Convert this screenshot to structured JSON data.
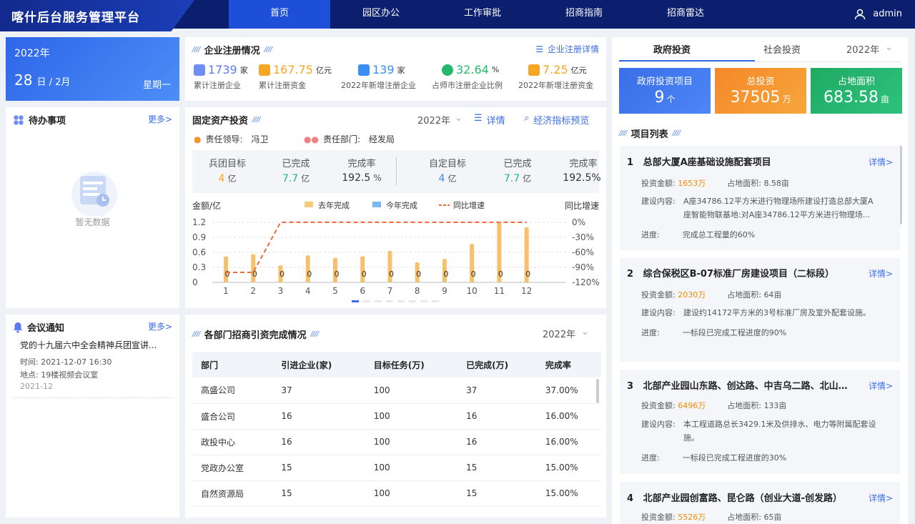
{
  "app": {
    "title": "喀什后台服务管理平台",
    "user": "admin"
  },
  "nav": [
    "首页",
    "园区办公",
    "工作审批",
    "招商指南",
    "招商雷达"
  ],
  "date": {
    "year": "2022年",
    "day": "28",
    "month": "日 / 2月",
    "weekday": "星期一"
  },
  "todo": {
    "title": "待办事项",
    "more": "更多>",
    "empty": "暂无数据"
  },
  "meeting": {
    "title": "会议通知",
    "more": "更多>",
    "item_title": "党的十九届六中全会精神兵团宣讲...",
    "time": "时间:  2021-12-07 16:30",
    "place": "地点:  19楼视频会议室",
    "date": "2021-12"
  },
  "reg": {
    "title": "企业注册情况",
    "detail": "企业注册详情",
    "stats": [
      {
        "value": "1739",
        "unit": "家",
        "label": "累计注册企业",
        "color": "#5b7bf2"
      },
      {
        "value": "167.75",
        "unit": "亿元",
        "label": "累计注册资金",
        "color": "#f5a623"
      },
      {
        "value": "139",
        "unit": "家",
        "label": "2022年新增注册企业",
        "color": "#3a8ef5"
      },
      {
        "value": "32.64",
        "unit": "%",
        "label": "占师市注册企业比例",
        "color": "#26b96e"
      },
      {
        "value": "7.25",
        "unit": "亿元",
        "label": "2022年新增注册资金",
        "color": "#f5a623"
      }
    ]
  },
  "fixed": {
    "title": "固定资产投资",
    "year": "2022年",
    "detail": "详情",
    "preview": "经济指标预览",
    "leader_label": "责任领导:",
    "leader": "冯卫",
    "dept_label": "责任部门:",
    "dept": "经发局",
    "targets": [
      {
        "label": "兵团目标",
        "value": "4",
        "unit": "亿"
      },
      {
        "label": "已完成",
        "value": "7.7",
        "unit": "亿"
      },
      {
        "label": "完成率",
        "value": "192.5",
        "unit": "%"
      },
      {
        "label": "自定目标",
        "value": "4",
        "unit": "亿"
      },
      {
        "label": "已完成",
        "value": "7.7",
        "unit": "亿"
      },
      {
        "label": "完成率",
        "value": "192.5%",
        "unit": ""
      }
    ]
  },
  "chart_data": {
    "type": "bar",
    "ylabel": "金额/亿",
    "y2label": "同比增速",
    "categories": [
      "1",
      "2",
      "3",
      "4",
      "5",
      "6",
      "7",
      "8",
      "9",
      "10",
      "11",
      "12"
    ],
    "series": [
      {
        "name": "去年完成",
        "values": [
          0.52,
          0.56,
          0.34,
          0.54,
          0.49,
          0.52,
          0.63,
          0.4,
          0.47,
          0.77,
          1.2,
          1.1
        ]
      },
      {
        "name": "今年完成",
        "values": [
          0,
          0,
          0,
          0,
          0,
          0,
          0,
          0,
          0,
          0,
          0,
          0
        ]
      },
      {
        "name": "同比增速",
        "values": [
          -100,
          -100,
          0,
          0,
          0,
          0,
          0,
          0,
          0,
          0,
          0,
          0
        ]
      }
    ],
    "data_labels": [
      "0",
      "0",
      "0",
      "0",
      "0",
      "0",
      "0",
      "0",
      "0",
      "0",
      "0",
      "0"
    ],
    "yticks": [
      "1.2",
      "0.9",
      "0.6",
      "0.3",
      "0"
    ],
    "y2ticks": [
      "0%",
      "-30%",
      "-60%",
      "-90%",
      "-120%"
    ],
    "ylim": [
      0,
      1.2
    ],
    "y2lim": [
      -120,
      0
    ]
  },
  "invest": {
    "title": "各部门招商引资完成情况",
    "year": "2022年",
    "columns": [
      "部门",
      "引进企业(家)",
      "目标任务(万)",
      "已完成(万)",
      "完成率"
    ],
    "rows": [
      [
        "高盛公司",
        "37",
        "100",
        "37",
        "37.00%"
      ],
      [
        "盛合公司",
        "16",
        "100",
        "16",
        "16.00%"
      ],
      [
        "政投中心",
        "16",
        "100",
        "16",
        "16.00%"
      ],
      [
        "党政办公室",
        "15",
        "100",
        "15",
        "15.00%"
      ],
      [
        "自然资源局",
        "15",
        "100",
        "15",
        "15.00%"
      ]
    ]
  },
  "right": {
    "tabs": [
      "政府投资",
      "社会投资"
    ],
    "year": "2022年",
    "kpis": [
      {
        "label": "政府投资项目",
        "value": "9",
        "unit": "个",
        "color": "#3a6ee8"
      },
      {
        "label": "总投资",
        "value": "37505",
        "unit": "万",
        "color": "#f5962a"
      },
      {
        "label": "占地面积",
        "value": "683.58",
        "unit": "亩",
        "color": "#23b06c"
      }
    ],
    "list_title": "项目列表",
    "projects": [
      {
        "no": "1",
        "name": "总部大厦A座基础设施配套项目",
        "detail": "详情>",
        "amount_label": "投资金额:",
        "amount": "1653万",
        "area_label": "占地面积:",
        "area": "8.58亩",
        "content_label": "建设内容:",
        "content1": "A座34786.12平方米进行物理场所建设打造总部大厦A",
        "content2": "座智能物联基地:对A座34786.12平方米进行物理场...",
        "progress_label": "进度:",
        "progress": "完成总工程量的60%"
      },
      {
        "no": "2",
        "name": "综合保税区B-07标准厂房建设项目（二标段）",
        "detail": "详情>",
        "amount_label": "投资金额:",
        "amount": "2030万",
        "area_label": "占地面积:",
        "area": "64亩",
        "content_label": "建设内容:",
        "content1": "建设约14172平方米的3号标准厂房及室外配套设施。",
        "content2": "",
        "progress_label": "进度:",
        "progress": "一标段已完成工程进度的90%"
      },
      {
        "no": "3",
        "name": "北部产业园山东路、创达路、中吉乌二路、北山...",
        "detail": "详情>",
        "amount_label": "投资金额:",
        "amount": "6496万",
        "area_label": "占地面积:",
        "area": "133亩",
        "content_label": "建设内容:",
        "content1": "本工程道路总长3429.1米及供排水、电力等附属配套设",
        "content2": "施。",
        "progress_label": "进度:",
        "progress": "一标段已完成工程进度的30%"
      },
      {
        "no": "4",
        "name": "北部产业园创富路、昆仑路（创业大道-创发路）",
        "detail": "详情>",
        "amount_label": "投资金额:",
        "amount": "5526万",
        "area_label": "占地面积:",
        "area": "65亩"
      }
    ]
  }
}
